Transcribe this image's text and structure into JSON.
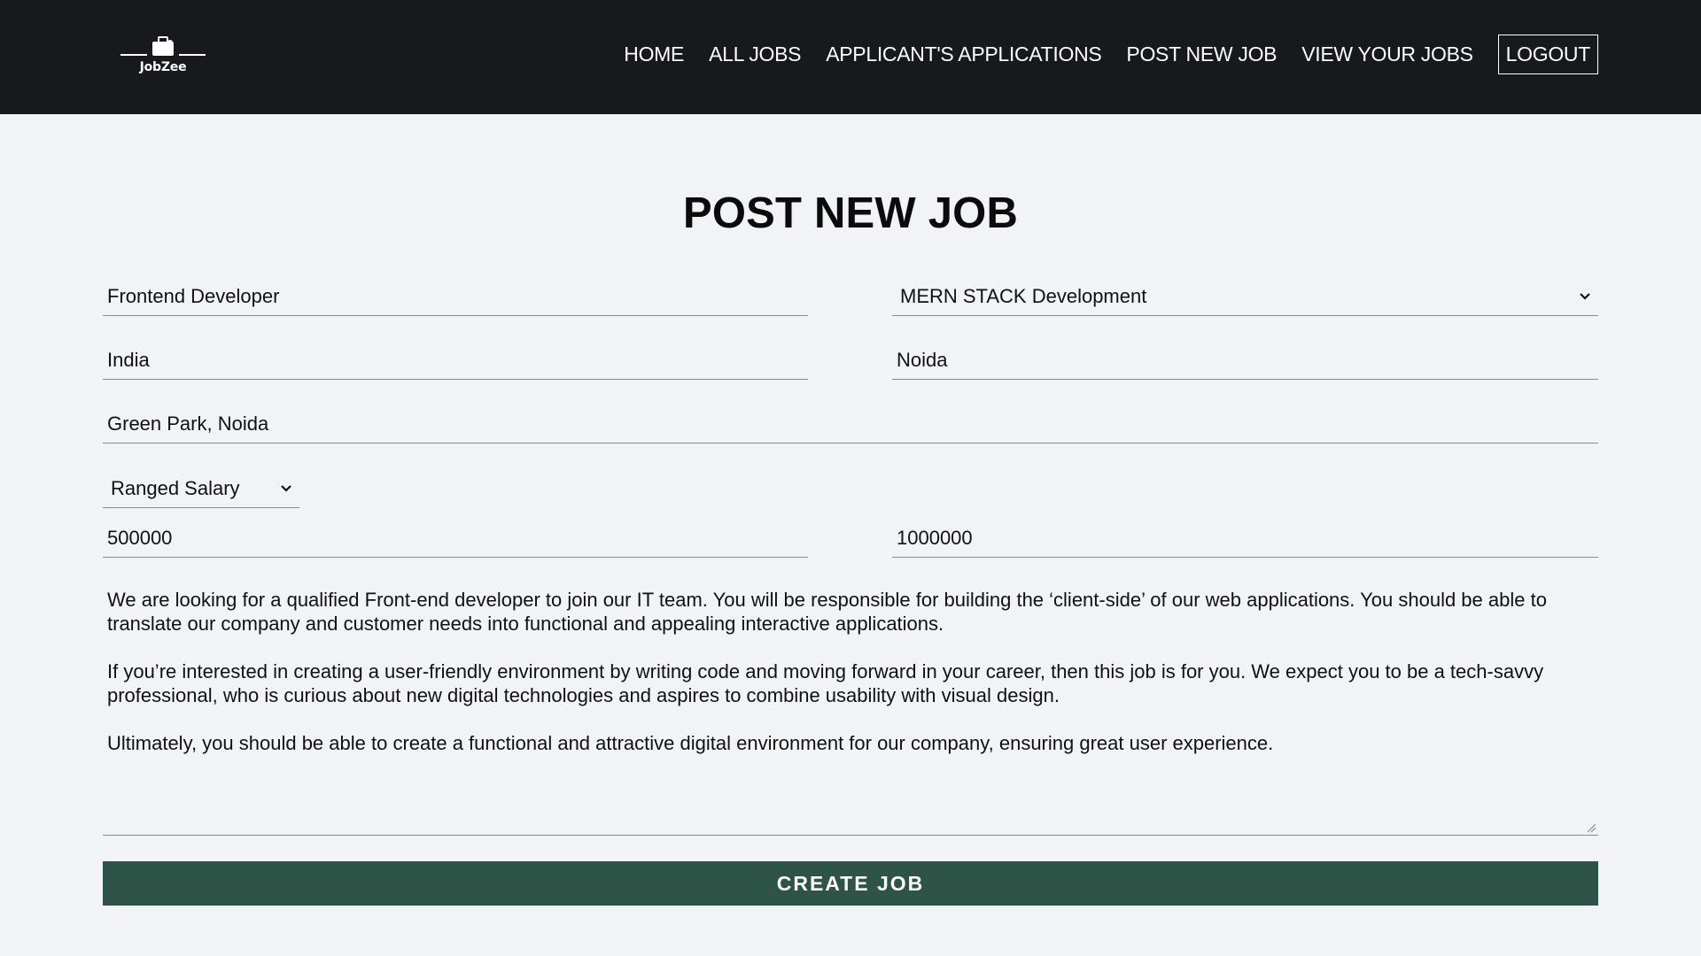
{
  "header": {
    "logo_text": "JobZee",
    "nav": {
      "home": "HOME",
      "all_jobs": "ALL JOBS",
      "applications": "APPLICANT'S APPLICATIONS",
      "post_job": "POST NEW JOB",
      "view_jobs": "VIEW YOUR JOBS",
      "logout": "LOGOUT"
    }
  },
  "form": {
    "title": "POST NEW JOB",
    "job_title": "Frontend Developer",
    "category": "MERN STACK Development",
    "country": "India",
    "city": "Noida",
    "location": "Green Park, Noida",
    "salary_type": "Ranged Salary",
    "salary_from": "500000",
    "salary_to": "1000000",
    "description": [
      "We are looking for a qualified Front-end developer to join our IT team. You will be responsible for building the ‘client-side’ of our web applications. You should be able to translate our company and customer needs into functional and appealing interactive applications.",
      "If you’re interested in creating a user-friendly environment by writing code and moving forward in your career, then this job is for you. We expect you to be a tech-savvy professional, who is curious about new digital technologies and aspires to combine usability with visual design.",
      "Ultimately, you should be able to create a functional and attractive digital environment for our company, ensuring great user experience."
    ],
    "submit_label": "CREATE JOB"
  },
  "icons": {
    "logo": "briefcase-logo-icon",
    "dropdown": "chevron-down-icon",
    "resize": "resize-handle-icon"
  },
  "colors": {
    "navbar_bg": "#18191d",
    "page_bg": "#f1f3f6",
    "button_bg": "#2d5446"
  }
}
